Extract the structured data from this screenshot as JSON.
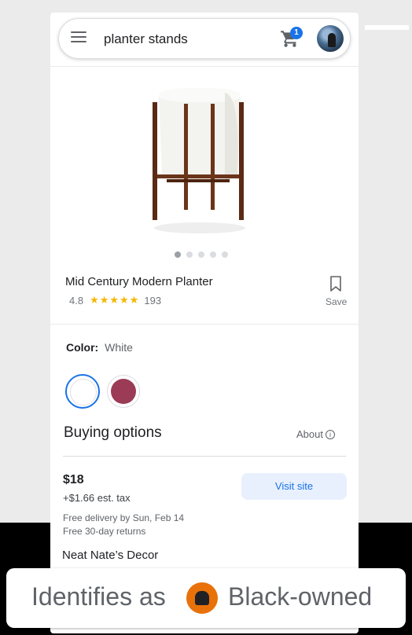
{
  "search": {
    "query": "planter stands"
  },
  "cart": {
    "badge_count": "1"
  },
  "product": {
    "title": "Mid Century Modern Planter",
    "rating": "4.8",
    "stars": "★★★★★",
    "review_count": "193",
    "save_label": "Save",
    "image_count": 5,
    "active_image": 1
  },
  "color": {
    "label": "Color:",
    "value": "White",
    "options": [
      "White",
      "Berry"
    ]
  },
  "buying": {
    "title": "Buying options",
    "about_label": "About",
    "info_glyph": "i",
    "offer": {
      "price": "$18",
      "tax": "+$1.66 est. tax",
      "visit_label": "Visit site",
      "delivery": "Free delivery by Sun, Feb 14",
      "returns": "Free 30-day returns",
      "seller": "Neat Nate’s Decor"
    }
  },
  "overlay": {
    "text_before": "Identifies as",
    "text_after": "Black-owned",
    "icon": "black-owned-badge-icon"
  },
  "colors": {
    "accent": "#1a73e8",
    "star": "#f6b700",
    "swatch_berry": "#9b3b55",
    "badge_orange": "#e8710a"
  }
}
